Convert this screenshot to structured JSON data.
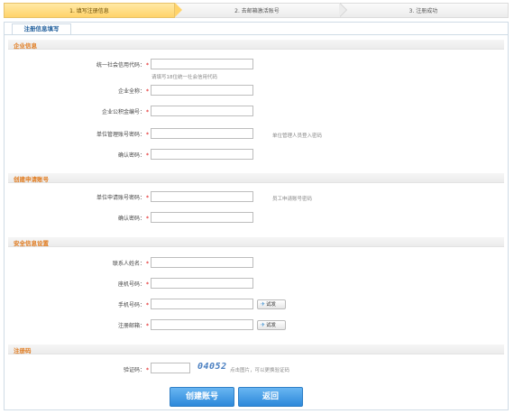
{
  "steps": {
    "step1": "1. 填写注册信息",
    "step2": "2. 去邮箱激活账号",
    "step3": "3. 注册成功"
  },
  "tab": {
    "label": "注册信息填写"
  },
  "sections": {
    "company": "企业信息",
    "account": "创建申请账号",
    "security": "安全信息设置",
    "regcode": "注册码"
  },
  "fields": {
    "credit_code": {
      "label": "统一社会信用代码：",
      "value": "",
      "hint": "请填写18位统一社会信用代码"
    },
    "company_name": {
      "label": "企业全称：",
      "value": ""
    },
    "fund_no": {
      "label": "企业公积金编号：",
      "value": ""
    },
    "admin_password": {
      "label": "单位管理账号密码：",
      "value": "",
      "hint": "单位管理人员登入密码"
    },
    "confirm_password_1": {
      "label": "确认密码：",
      "value": ""
    },
    "apply_password": {
      "label": "单位申请账号密码：",
      "value": "",
      "hint": "员工申请账号密码"
    },
    "confirm_password_2": {
      "label": "确认密码：",
      "value": ""
    },
    "contact_name": {
      "label": "联系人姓名：",
      "value": ""
    },
    "landline": {
      "label": "座机号码：",
      "value": ""
    },
    "mobile": {
      "label": "手机号码：",
      "value": "",
      "button": "试发"
    },
    "email": {
      "label": "注册邮箱：",
      "value": "",
      "button": "试发"
    },
    "captcha": {
      "label": "验证码：",
      "value": "",
      "image_text": "04052",
      "hint": "点击图片，可以更换验证码"
    }
  },
  "required_mark": "*",
  "buttons": {
    "create": "创建账号",
    "back": "返回"
  },
  "colors": {
    "section_title": "#e07b1f",
    "primary_button": "#2c88da",
    "active_step": "#ffd36a"
  },
  "icons": {
    "test_button": "send-icon"
  }
}
